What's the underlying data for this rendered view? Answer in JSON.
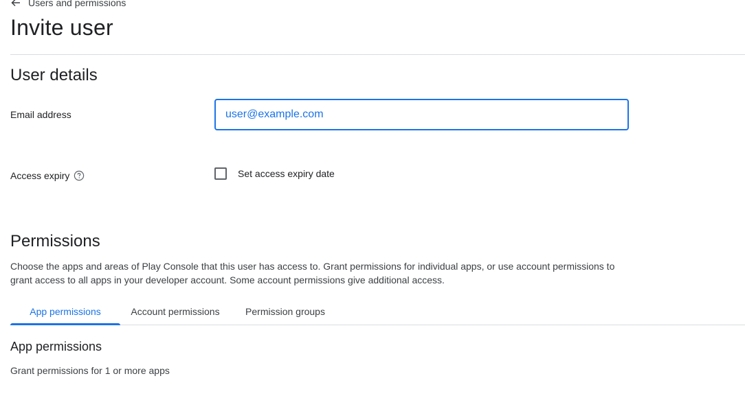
{
  "header": {
    "back_label": "Users and permissions",
    "title": "Invite user"
  },
  "user_details": {
    "title": "User details",
    "email": {
      "label": "Email address",
      "placeholder": "user@example.com",
      "value": ""
    },
    "access_expiry": {
      "label": "Access expiry",
      "checkbox_label": "Set access expiry date",
      "checked": false
    }
  },
  "permissions": {
    "title": "Permissions",
    "description": "Choose the apps and areas of Play Console that this user has access to. Grant permissions for individual apps, or use account permissions to grant access to all apps in your developer account. Some account permissions give additional access.",
    "tabs": [
      {
        "label": "App permissions",
        "active": true
      },
      {
        "label": "Account permissions",
        "active": false
      },
      {
        "label": "Permission groups",
        "active": false
      }
    ],
    "app_permissions": {
      "title": "App permissions",
      "description": "Grant permissions for 1 or more apps"
    }
  },
  "colors": {
    "accent": "#1a73e8",
    "text": "#202124",
    "secondary_text": "#3c4043",
    "divider": "#dadce0"
  },
  "icons": {
    "back": "arrow-left-icon",
    "help": "help-circle-icon"
  }
}
